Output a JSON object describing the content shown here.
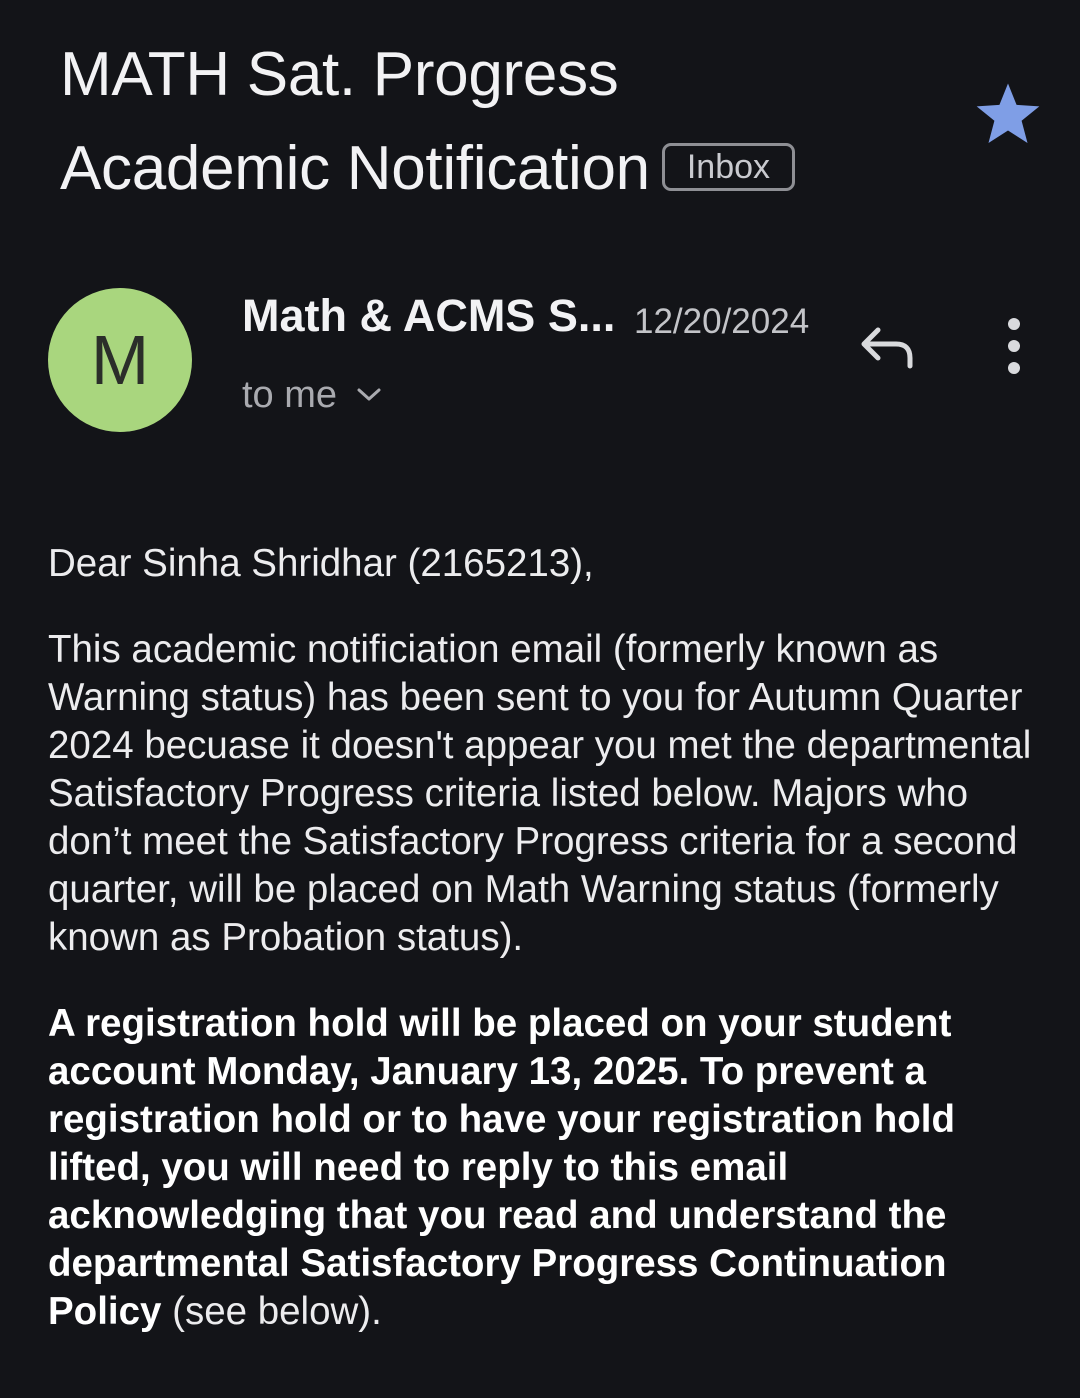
{
  "email": {
    "subject_line1": "MATH Sat. Progress",
    "subject_line2": "Academic Notification",
    "label": "Inbox",
    "sender": {
      "initial": "M",
      "name": "Math & ACMS S...",
      "date": "12/20/2024",
      "recipient": "to me"
    },
    "body": {
      "greeting": "Dear Sinha Shridhar (2165213),",
      "paragraph1": "This academic notificiation email (formerly known as Warning status) has been sent to you for Autumn Quarter 2024 becuase it doesn't appear you met the departmental Satisfactory Progress criteria listed below. Majors who don’t meet the Satisfactory Progress criteria for a second quarter, will be placed on Math Warning status (formerly known as Probation status).",
      "paragraph2_bold": "A registration hold will be placed on your student account Monday, January 13, 2025. To prevent a registration hold or to have your registration hold lifted, you will need to reply to this email acknowledging that you read and understand the departmental Satisfactory Progress Continuation Policy",
      "paragraph2_tail": " (see below)."
    }
  },
  "icons": {
    "star": "star-icon",
    "reply": "reply-icon",
    "more": "more-vert-icon",
    "expand": "chevron-down-icon"
  },
  "colors": {
    "background": "#131418",
    "avatar": "#a9d67e",
    "star": "#7f9ee6",
    "badge_border": "#8e8f94"
  }
}
